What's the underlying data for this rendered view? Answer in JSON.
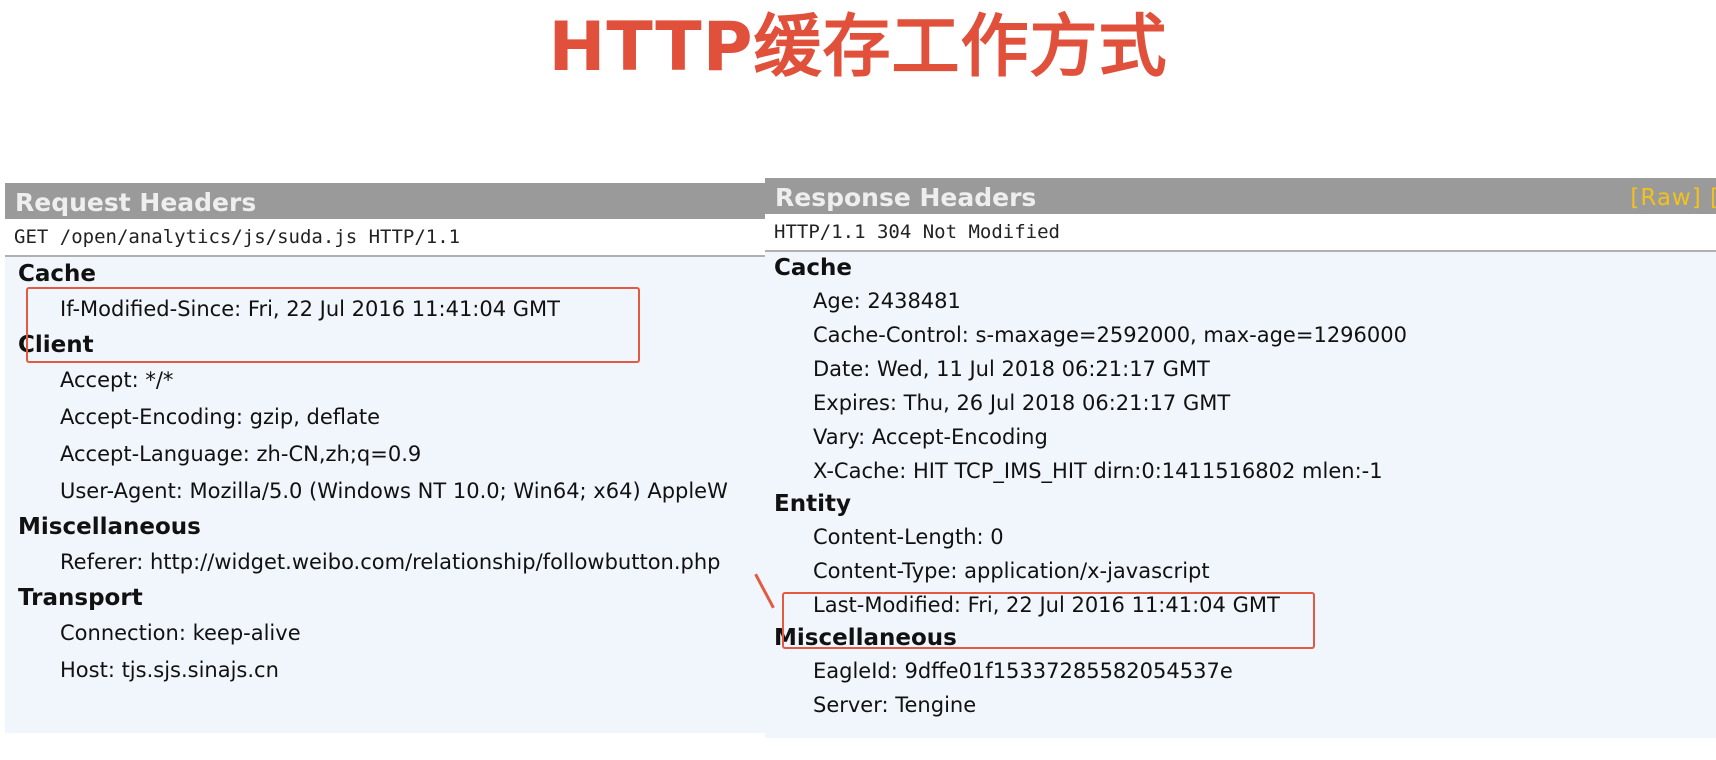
{
  "title": "HTTP缓存工作方式",
  "request": {
    "header_title": "Request Headers",
    "request_line": "GET /open/analytics/js/suda.js HTTP/1.1",
    "sections": [
      {
        "name": "Cache",
        "rows": [
          "If-Modified-Since: Fri, 22 Jul 2016 11:41:04 GMT"
        ]
      },
      {
        "name": "Client",
        "rows": [
          "Accept: */*",
          "Accept-Encoding: gzip, deflate",
          "Accept-Language: zh-CN,zh;q=0.9",
          "User-Agent: Mozilla/5.0 (Windows NT 10.0; Win64; x64) AppleW"
        ]
      },
      {
        "name": "Miscellaneous",
        "rows": [
          "Referer: http://widget.weibo.com/relationship/followbutton.php"
        ]
      },
      {
        "name": "Transport",
        "rows": [
          "Connection: keep-alive",
          "Host: tjs.sjs.sinajs.cn"
        ]
      }
    ]
  },
  "response": {
    "header_title": "Response Headers",
    "raw_link": "[Raw]  [",
    "status_line": "HTTP/1.1 304 Not Modified",
    "sections": [
      {
        "name": "Cache",
        "rows": [
          "Age: 2438481",
          "Cache-Control: s-maxage=2592000, max-age=1296000",
          "Date: Wed, 11 Jul 2018 06:21:17 GMT",
          "Expires: Thu, 26 Jul 2018 06:21:17 GMT",
          "Vary: Accept-Encoding",
          "X-Cache: HIT TCP_IMS_HIT dirn:0:1411516802 mlen:-1"
        ]
      },
      {
        "name": "Entity",
        "rows": [
          "Content-Length: 0",
          "Content-Type: application/x-javascript",
          "Last-Modified: Fri, 22 Jul 2016 11:41:04 GMT"
        ]
      },
      {
        "name": "Miscellaneous",
        "rows": [
          "EagleId: 9dffe01f15337285582054537e",
          "Server: Tengine"
        ]
      }
    ]
  }
}
